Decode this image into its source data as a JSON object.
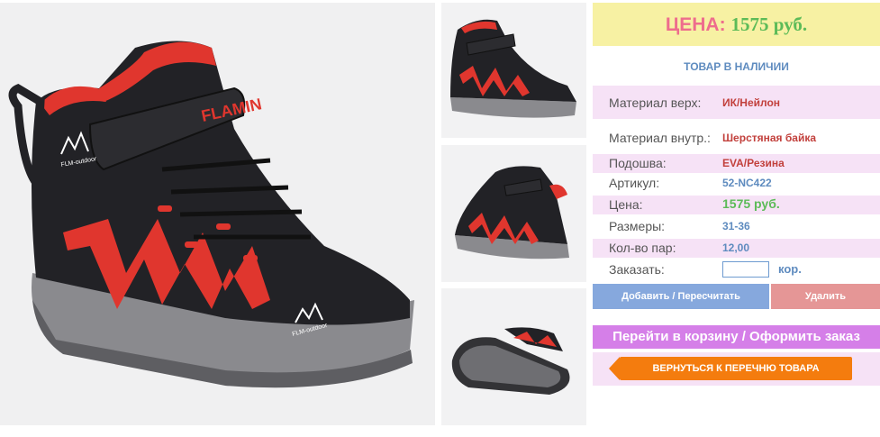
{
  "price_box": {
    "label": "ЦЕНА:",
    "value": "1575 руб."
  },
  "availability": "ТОВАР В НАЛИЧИИ",
  "details": [
    {
      "key": "Материал верх:",
      "value": "ИК/Нейлон"
    },
    {
      "key": "Материал внутр.:",
      "value": "Шерстяная байка"
    },
    {
      "key": "Подошва:",
      "value": "EVA/Резина"
    },
    {
      "key": "Артикул:",
      "value": "52-NC422"
    },
    {
      "key": "Цена:",
      "value": "1575 руб."
    },
    {
      "key": "Размеры:",
      "value": "31-36"
    },
    {
      "key": "Кол-во пар:",
      "value": "12,00"
    }
  ],
  "order": {
    "label": "Заказать:",
    "value": "",
    "unit": "кор."
  },
  "buttons": {
    "add": "Добавить / Пересчитать",
    "delete": "Удалить",
    "cart": "Перейти в корзину / Оформить заказ",
    "back": "ВЕРНУТЬСЯ К ПЕРЕЧНЮ ТОВАРА"
  },
  "product_images": {
    "main": {
      "brand_print": "FLAMINGO",
      "logo": "FLM-outdoor"
    },
    "thumbnails": [
      "side-view",
      "three-quarter-view",
      "sole-view"
    ]
  },
  "colors": {
    "boot_black": "#222226",
    "boot_red": "#e0362e",
    "sole_gray": "#8a8a8e",
    "price_bg": "#f7f1a3",
    "accent_blue": "#5e8bbf",
    "accent_green": "#5cbb58",
    "row_pink": "#f6e2f6",
    "back_orange": "#f47c0e"
  }
}
